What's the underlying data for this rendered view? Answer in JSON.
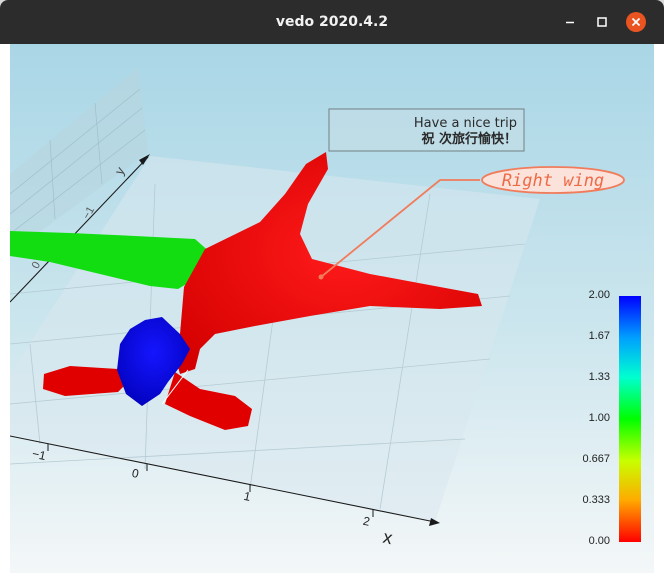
{
  "window": {
    "title": "vedo 2020.4.2"
  },
  "titlebar_buttons": {
    "minimize": "minimize-icon",
    "maximize": "maximize-icon",
    "close": "close-icon"
  },
  "scene": {
    "textbox": {
      "line1": "Have a nice trip",
      "line2": "祝  次旅行愉快！"
    },
    "flag_label": "Right wing",
    "axis_title_x": "x",
    "axis_title_y": "y",
    "x_ticks": [
      "−1",
      "0",
      "1",
      "2"
    ],
    "y_ticks": [
      "−1",
      "0"
    ],
    "colorbar": {
      "ticks": [
        "2.00",
        "1.67",
        "1.33",
        "1.00",
        "0.667",
        "0.333",
        "0.00"
      ]
    },
    "colors": {
      "red": "#ee0000",
      "green": "#11dd11",
      "blue": "#0a0ad8",
      "flag": "#f07c5c"
    }
  }
}
